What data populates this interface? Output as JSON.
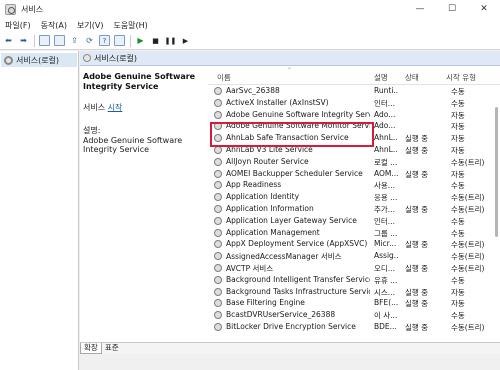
{
  "window": {
    "title": "서비스",
    "controls": [
      "—",
      "☐",
      "✕"
    ]
  },
  "menu": [
    "파일(F)",
    "동작(A)",
    "보기(V)",
    "도움말(H)"
  ],
  "toolbar": {
    "icons": [
      "back-arrow-icon",
      "forward-arrow-icon",
      "console-tree-icon",
      "properties-icon",
      "export-icon",
      "refresh-icon",
      "help-icon",
      "console-icon",
      "start-icon",
      "stop-icon",
      "pause-icon",
      "restart-icon"
    ]
  },
  "tree": {
    "root_label": "서비스(로컬)"
  },
  "pane": {
    "header": "서비스(로컬)"
  },
  "detail": {
    "title": "Adobe Genuine Software Integrity Service",
    "action_prefix": "서비스 ",
    "action_link": "시작",
    "desc_label": "설명:",
    "desc_text": "Adobe Genuine Software Integrity Service"
  },
  "columns": {
    "name": "이름",
    "desc": "설명",
    "status": "상태",
    "start": "시작 유형"
  },
  "services": [
    {
      "name": "AarSvc_26388",
      "desc": "Runti...",
      "status": "",
      "start": "수동"
    },
    {
      "name": "ActiveX Installer (AxInstSV)",
      "desc": "인터...",
      "status": "",
      "start": "수동"
    },
    {
      "name": "Adobe Genuine Software Integrity Service",
      "desc": "Ado...",
      "status": "",
      "start": "자동"
    },
    {
      "name": "Adobe Genuine Software Monitor Service",
      "desc": "Ado...",
      "status": "",
      "start": "자동"
    },
    {
      "name": "AhnLab Safe Transaction Service",
      "desc": "AhnL...",
      "status": "실행 중",
      "start": "자동"
    },
    {
      "name": "AhnLab V3 Lite Service",
      "desc": "AhnL...",
      "status": "실행 중",
      "start": "자동"
    },
    {
      "name": "AllJoyn Router Service",
      "desc": "로컬 ...",
      "status": "",
      "start": "수동(트리)"
    },
    {
      "name": "AOMEI Backupper Scheduler Service",
      "desc": "AOM...",
      "status": "실행 중",
      "start": "자동"
    },
    {
      "name": "App Readiness",
      "desc": "사용...",
      "status": "",
      "start": "수동"
    },
    {
      "name": "Application Identity",
      "desc": "응용 ...",
      "status": "",
      "start": "수동(트리)"
    },
    {
      "name": "Application Information",
      "desc": "추가...",
      "status": "실행 중",
      "start": "수동(트리)"
    },
    {
      "name": "Application Layer Gateway Service",
      "desc": "인터...",
      "status": "",
      "start": "수동"
    },
    {
      "name": "Application Management",
      "desc": "그룹 ...",
      "status": "",
      "start": "수동"
    },
    {
      "name": "AppX Deployment Service (AppXSVC)",
      "desc": "Micr...",
      "status": "실행 중",
      "start": "수동(트리)"
    },
    {
      "name": "AssignedAccessManager 서비스",
      "desc": "Assig...",
      "status": "",
      "start": "수동(트리)"
    },
    {
      "name": "AVCTP 서비스",
      "desc": "오디...",
      "status": "실행 중",
      "start": "수동(트리)"
    },
    {
      "name": "Background Intelligent Transfer Service",
      "desc": "유휴 ...",
      "status": "",
      "start": "수동"
    },
    {
      "name": "Background Tasks Infrastructure Service",
      "desc": "시스...",
      "status": "실행 중",
      "start": "자동"
    },
    {
      "name": "Base Filtering Engine",
      "desc": "BFE(...",
      "status": "실행 중",
      "start": "자동"
    },
    {
      "name": "BcastDVRUserService_26388",
      "desc": "이 사...",
      "status": "",
      "start": "수동"
    },
    {
      "name": "BitLocker Drive Encryption Service",
      "desc": "BDE...",
      "status": "실행 중",
      "start": "수동(트리)"
    }
  ],
  "tabs": [
    "확장",
    "표준"
  ],
  "colors": {
    "highlight": "#d81b3c",
    "link": "#1a5fb4",
    "header_bg": "#dfe8f5"
  }
}
